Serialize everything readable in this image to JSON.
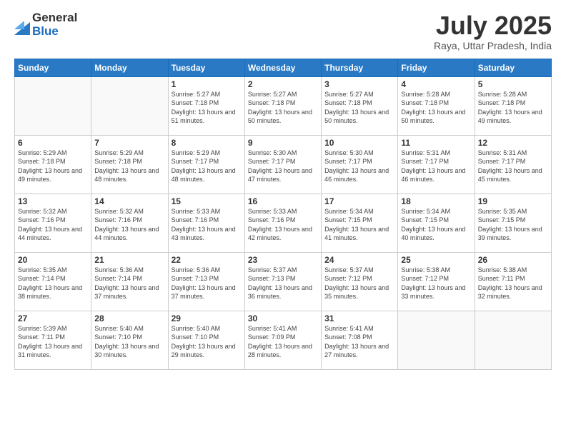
{
  "logo": {
    "general": "General",
    "blue": "Blue"
  },
  "title": "July 2025",
  "subtitle": "Raya, Uttar Pradesh, India",
  "days_header": [
    "Sunday",
    "Monday",
    "Tuesday",
    "Wednesday",
    "Thursday",
    "Friday",
    "Saturday"
  ],
  "weeks": [
    [
      {
        "day": "",
        "info": ""
      },
      {
        "day": "",
        "info": ""
      },
      {
        "day": "1",
        "info": "Sunrise: 5:27 AM\nSunset: 7:18 PM\nDaylight: 13 hours and 51 minutes."
      },
      {
        "day": "2",
        "info": "Sunrise: 5:27 AM\nSunset: 7:18 PM\nDaylight: 13 hours and 50 minutes."
      },
      {
        "day": "3",
        "info": "Sunrise: 5:27 AM\nSunset: 7:18 PM\nDaylight: 13 hours and 50 minutes."
      },
      {
        "day": "4",
        "info": "Sunrise: 5:28 AM\nSunset: 7:18 PM\nDaylight: 13 hours and 50 minutes."
      },
      {
        "day": "5",
        "info": "Sunrise: 5:28 AM\nSunset: 7:18 PM\nDaylight: 13 hours and 49 minutes."
      }
    ],
    [
      {
        "day": "6",
        "info": "Sunrise: 5:29 AM\nSunset: 7:18 PM\nDaylight: 13 hours and 49 minutes."
      },
      {
        "day": "7",
        "info": "Sunrise: 5:29 AM\nSunset: 7:18 PM\nDaylight: 13 hours and 48 minutes."
      },
      {
        "day": "8",
        "info": "Sunrise: 5:29 AM\nSunset: 7:17 PM\nDaylight: 13 hours and 48 minutes."
      },
      {
        "day": "9",
        "info": "Sunrise: 5:30 AM\nSunset: 7:17 PM\nDaylight: 13 hours and 47 minutes."
      },
      {
        "day": "10",
        "info": "Sunrise: 5:30 AM\nSunset: 7:17 PM\nDaylight: 13 hours and 46 minutes."
      },
      {
        "day": "11",
        "info": "Sunrise: 5:31 AM\nSunset: 7:17 PM\nDaylight: 13 hours and 46 minutes."
      },
      {
        "day": "12",
        "info": "Sunrise: 5:31 AM\nSunset: 7:17 PM\nDaylight: 13 hours and 45 minutes."
      }
    ],
    [
      {
        "day": "13",
        "info": "Sunrise: 5:32 AM\nSunset: 7:16 PM\nDaylight: 13 hours and 44 minutes."
      },
      {
        "day": "14",
        "info": "Sunrise: 5:32 AM\nSunset: 7:16 PM\nDaylight: 13 hours and 44 minutes."
      },
      {
        "day": "15",
        "info": "Sunrise: 5:33 AM\nSunset: 7:16 PM\nDaylight: 13 hours and 43 minutes."
      },
      {
        "day": "16",
        "info": "Sunrise: 5:33 AM\nSunset: 7:16 PM\nDaylight: 13 hours and 42 minutes."
      },
      {
        "day": "17",
        "info": "Sunrise: 5:34 AM\nSunset: 7:15 PM\nDaylight: 13 hours and 41 minutes."
      },
      {
        "day": "18",
        "info": "Sunrise: 5:34 AM\nSunset: 7:15 PM\nDaylight: 13 hours and 40 minutes."
      },
      {
        "day": "19",
        "info": "Sunrise: 5:35 AM\nSunset: 7:15 PM\nDaylight: 13 hours and 39 minutes."
      }
    ],
    [
      {
        "day": "20",
        "info": "Sunrise: 5:35 AM\nSunset: 7:14 PM\nDaylight: 13 hours and 38 minutes."
      },
      {
        "day": "21",
        "info": "Sunrise: 5:36 AM\nSunset: 7:14 PM\nDaylight: 13 hours and 37 minutes."
      },
      {
        "day": "22",
        "info": "Sunrise: 5:36 AM\nSunset: 7:13 PM\nDaylight: 13 hours and 37 minutes."
      },
      {
        "day": "23",
        "info": "Sunrise: 5:37 AM\nSunset: 7:13 PM\nDaylight: 13 hours and 36 minutes."
      },
      {
        "day": "24",
        "info": "Sunrise: 5:37 AM\nSunset: 7:12 PM\nDaylight: 13 hours and 35 minutes."
      },
      {
        "day": "25",
        "info": "Sunrise: 5:38 AM\nSunset: 7:12 PM\nDaylight: 13 hours and 33 minutes."
      },
      {
        "day": "26",
        "info": "Sunrise: 5:38 AM\nSunset: 7:11 PM\nDaylight: 13 hours and 32 minutes."
      }
    ],
    [
      {
        "day": "27",
        "info": "Sunrise: 5:39 AM\nSunset: 7:11 PM\nDaylight: 13 hours and 31 minutes."
      },
      {
        "day": "28",
        "info": "Sunrise: 5:40 AM\nSunset: 7:10 PM\nDaylight: 13 hours and 30 minutes."
      },
      {
        "day": "29",
        "info": "Sunrise: 5:40 AM\nSunset: 7:10 PM\nDaylight: 13 hours and 29 minutes."
      },
      {
        "day": "30",
        "info": "Sunrise: 5:41 AM\nSunset: 7:09 PM\nDaylight: 13 hours and 28 minutes."
      },
      {
        "day": "31",
        "info": "Sunrise: 5:41 AM\nSunset: 7:08 PM\nDaylight: 13 hours and 27 minutes."
      },
      {
        "day": "",
        "info": ""
      },
      {
        "day": "",
        "info": ""
      }
    ]
  ]
}
